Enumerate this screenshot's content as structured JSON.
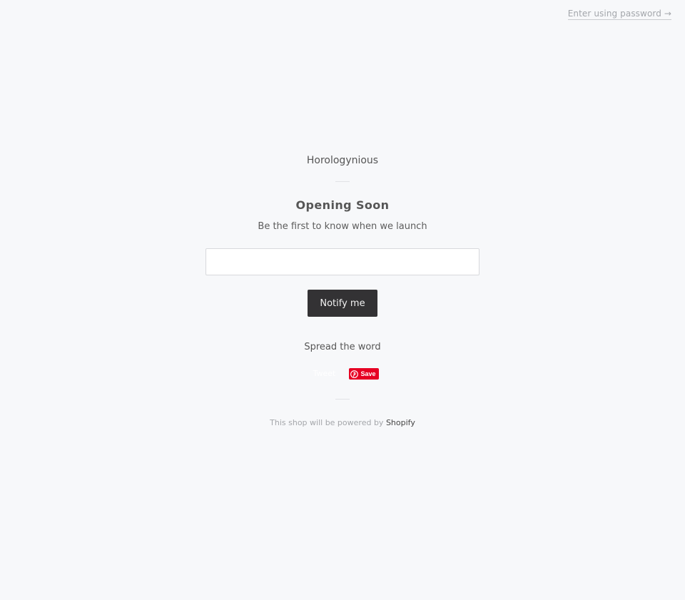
{
  "header": {
    "password_link": "Enter using password →"
  },
  "main": {
    "shop_name": "Horologynious",
    "title": "Opening Soon",
    "subtitle": "Be the first to know when we launch",
    "email_value": "",
    "notify_label": "Notify me",
    "spread_label": "Spread the word",
    "tweet_label": "Tweet",
    "pin_label": "Save"
  },
  "footer": {
    "powered_prefix": "This shop will be powered by",
    "powered_link": "Shopify"
  },
  "colors": {
    "background": "#f7f8fa",
    "button": "#333234",
    "pinterest": "#e60023"
  },
  "icons": {
    "pinterest": "pinterest-icon"
  }
}
